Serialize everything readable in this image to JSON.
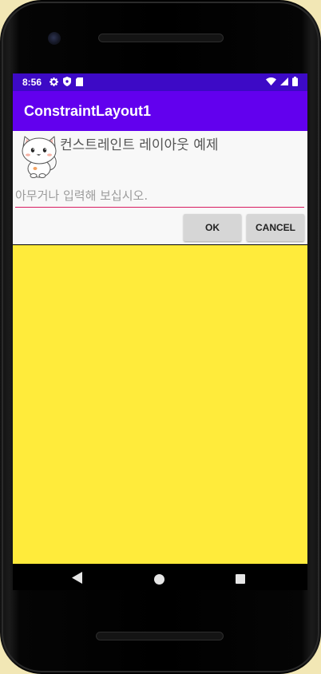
{
  "status_bar": {
    "time": "8:56",
    "left_icons": [
      "settings-icon",
      "shield-icon",
      "sd-card-icon"
    ],
    "right_icons": [
      "wifi-icon",
      "cell-signal-icon",
      "battery-icon"
    ]
  },
  "app_bar": {
    "title": "ConstraintLayout1"
  },
  "content": {
    "image_icon": "cat-image",
    "heading": "컨스트레인트 레이아웃 예제",
    "input": {
      "value": "",
      "placeholder": "아무거나 입력해 보십시오."
    },
    "ok_label": "OK",
    "cancel_label": "CANCEL"
  },
  "nav_bar": {
    "icons": [
      "back-icon",
      "home-icon",
      "recents-icon"
    ]
  },
  "colors": {
    "status_bar": "#3d0ac6",
    "app_bar": "#6200ee",
    "yellow_area": "#ffeb3b",
    "input_underline": "#d81b60"
  }
}
